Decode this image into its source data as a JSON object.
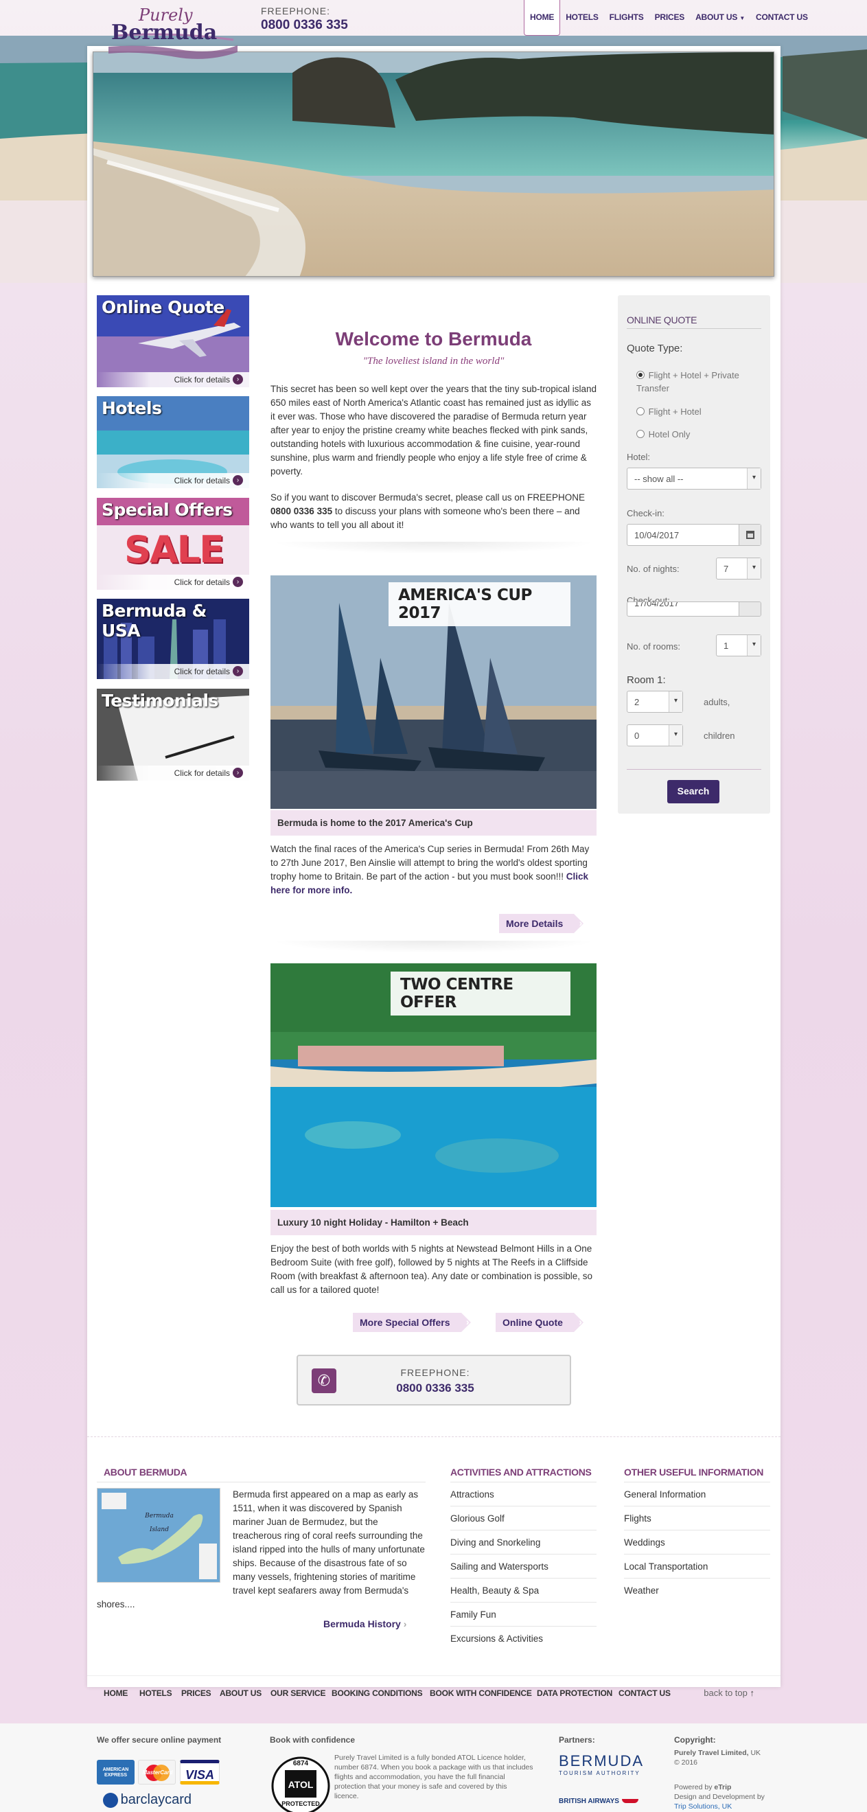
{
  "header": {
    "logo_top": "Purely",
    "logo_bottom": "Bermuda",
    "freephone_label": "FREEPHONE:",
    "freephone_number": "0800 0336 335",
    "nav": [
      "HOME",
      "HOTELS",
      "FLIGHTS",
      "PRICES",
      "ABOUT US",
      "CONTACT US"
    ]
  },
  "sidebar": {
    "promos": [
      {
        "title": "Online Quote",
        "cta": "Click for details"
      },
      {
        "title": "Hotels",
        "cta": "Click for details"
      },
      {
        "title": "Special Offers",
        "cta": "Click for details",
        "graphic_text": "SALE"
      },
      {
        "title": "Bermuda & USA",
        "cta": "Click for details"
      },
      {
        "title": "Testimonials",
        "cta": "Click for details"
      }
    ]
  },
  "welcome": {
    "title": "Welcome to Bermuda",
    "subtitle": "\"The loveliest island in the world\"",
    "para1": "This secret has been so well kept over the years that the tiny sub-tropical island 650 miles east of North America's Atlantic coast has remained just as idyllic as it ever was. Those who have discovered the paradise of Bermuda return year after year to enjoy the pristine creamy white beaches flecked with pink sands, outstanding hotels with luxurious accommodation & fine cuisine, year-round sunshine, plus warm and friendly people who enjoy a life style free of crime & poverty.",
    "para2_before": "So if you want to discover Bermuda's secret, please call us on FREEPHONE ",
    "para2_phone": "0800 0336 335",
    "para2_after": " to discuss your plans with someone who's been there – and who wants to tell you all about it!"
  },
  "offers": [
    {
      "banner": "AMERICA'S CUP 2017",
      "caption": "Bermuda is home to the 2017 America's Cup",
      "text": "Watch the final races of the America's Cup series in Bermuda! From 26th May to 27th June 2017, Ben Ainslie will attempt to bring the world's oldest sporting trophy home to Britain. Be part of the action - but you must book soon!!! ",
      "link": "Click here for more info.",
      "button": "More Details"
    },
    {
      "banner": "TWO CENTRE OFFER",
      "caption": "Luxury 10 night Holiday - Hamilton + Beach",
      "text": "Enjoy the best of both worlds with 5 nights at Newstead Belmont Hills in a One Bedroom Suite (with free golf), followed by 5 nights at The Reefs in a Cliffside Room (with breakfast & afternoon tea). Any date or combination is possible, so call us for a tailored quote!",
      "button1": "More Special Offers",
      "button2": "Online Quote"
    }
  ],
  "freephone_box": {
    "label": "FREEPHONE:",
    "number": "0800 0336 335"
  },
  "quote": {
    "heading": "ONLINE QUOTE",
    "quote_type_label": "Quote Type:",
    "options": [
      "Flight + Hotel + Private Transfer",
      "Flight + Hotel",
      "Hotel Only"
    ],
    "hotel_label": "Hotel:",
    "hotel_value": "-- show all --",
    "checkin_label": "Check-in:",
    "checkin_value": "10/04/2017",
    "nights_label": "No. of nights:",
    "nights_value": "7",
    "checkout_label": "Check-out:",
    "checkout_value": "17/04/2017",
    "rooms_label": "No. of rooms:",
    "rooms_value": "1",
    "room1_label": "Room 1:",
    "adults_value": "2",
    "adults_label": "adults,",
    "children_value": "0",
    "children_label": "children",
    "search": "Search"
  },
  "about": {
    "title": "ABOUT BERMUDA",
    "map_label": "Bermuda Island",
    "text": "Bermuda first appeared on a map as early as 1511, when it was discovered by Spanish mariner Juan de Bermudez, but the treacherous ring of coral reefs surrounding the island ripped into the hulls of many unfortunate ships. Because of the disastrous fate of so many vessels, frightening stories of maritime travel kept seafarers away from Bermuda's shores....",
    "link": "Bermuda History"
  },
  "activities": {
    "title": "ACTIVITIES AND ATTRACTIONS",
    "items": [
      "Attractions",
      "Glorious Golf",
      "Diving and Snorkeling",
      "Sailing and Watersports",
      "Health, Beauty & Spa",
      "Family Fun",
      "Excursions & Activities"
    ]
  },
  "useful": {
    "title": "OTHER USEFUL INFORMATION",
    "items": [
      "General Information",
      "Flights",
      "Weddings",
      "Local Transportation",
      "Weather"
    ]
  },
  "footer_nav": {
    "items": [
      "HOME",
      "HOTELS",
      "PRICES",
      "ABOUT US",
      "OUR SERVICE",
      "BOOKING CONDITIONS",
      "BOOK WITH CONFIDENCE",
      "DATA PROTECTION",
      "CONTACT US"
    ],
    "back_to_top": "back to top"
  },
  "footer": {
    "payment_head": "We offer secure online payment",
    "cards": [
      "AMERICAN EXPRESS",
      "MasterCard",
      "VISA"
    ],
    "barclaycard": "barclaycard",
    "confidence_head": "Book with confidence",
    "atol_number": "6874",
    "atol_word": "ATOL",
    "atol_protected": "PROTECTED",
    "confidence_text": "Purely Travel Limited is a fully bonded ATOL Licence holder, number 6874. When you book a package with us that includes flights and accommodation, you have the full financial protection that your money is safe and covered by this licence.",
    "partners_head": "Partners:",
    "partner1": "BERMUDA",
    "partner1_sub": "TOURISM AUTHORITY",
    "partner2": "BRITISH AIRWAYS",
    "copyright_head": "Copyright:",
    "copyright_company": "Purely Travel Limited,",
    "copyright_country": " UK",
    "copyright_year": "© 2016",
    "powered_label": "Powered by ",
    "powered_name": "eTrip",
    "design_label": "Design and Development by",
    "design_name": "Trip Solutions, UK"
  },
  "colors": {
    "brand_purple": "#3d2a6a",
    "accent_plum": "#7c3e77",
    "caption_pink": "#f2e3f0"
  }
}
